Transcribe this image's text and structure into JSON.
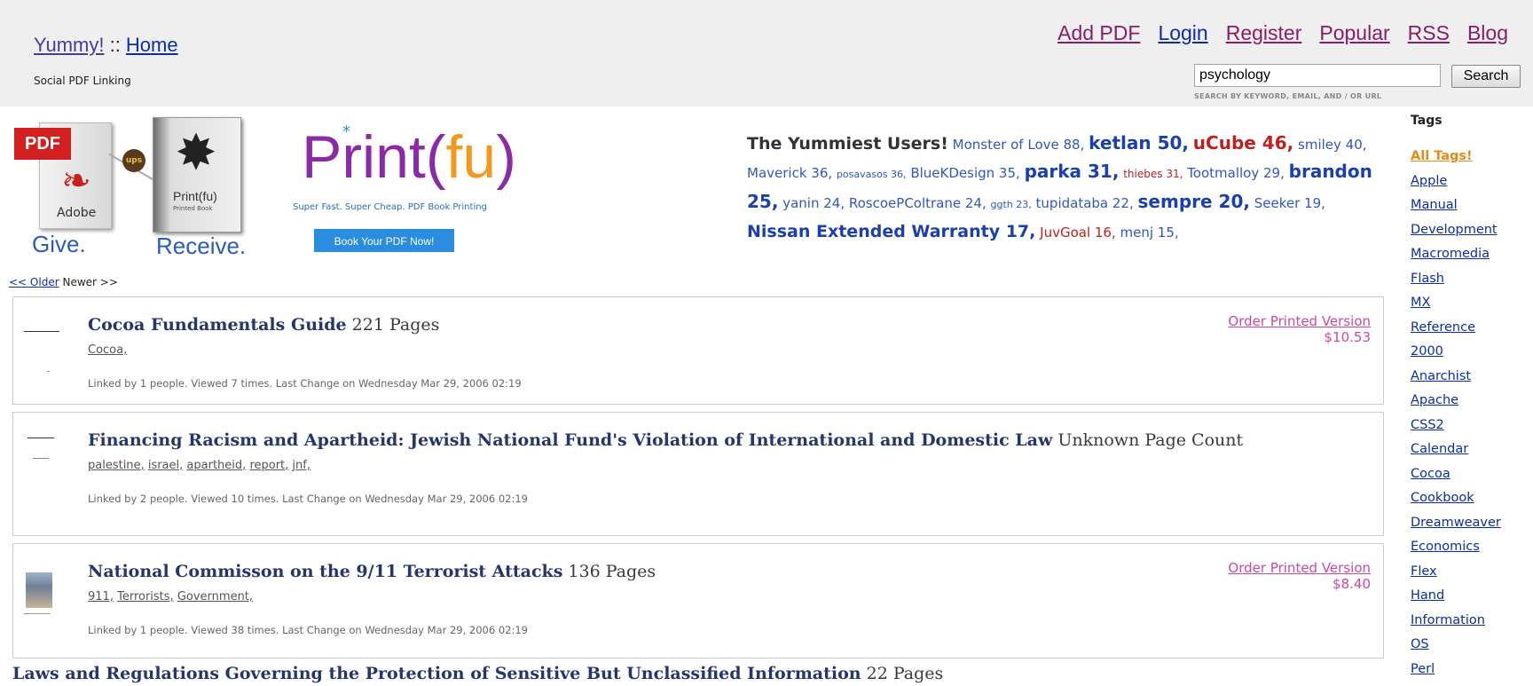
{
  "header": {
    "brand": "Yummy!",
    "separator": " :: ",
    "home": "Home",
    "tagline": "Social PDF Linking",
    "nav": [
      "Add PDF",
      "Login",
      "Register",
      "Popular",
      "RSS",
      "Blog"
    ],
    "search": {
      "value": "psychology",
      "button": "Search",
      "hint": "SEARCH BY KEYWORD, EMAIL, AND / OR URL"
    }
  },
  "banner": {
    "pdf_tag": "PDF",
    "adobe": "Adobe",
    "ups": "ups",
    "book_title": "Print(fu)",
    "book_sub": "Printed Book",
    "give": "Give.",
    "receive": "Receive.",
    "printfu_left": "Print(",
    "printfu_fu": "fu",
    "printfu_right": ")",
    "printfu_sub": "Super Fast. Super Cheap. PDF Book Printing",
    "printfu_button": "Book Your PDF Now!"
  },
  "users": {
    "lead": "The Yummiest Users!",
    "list": [
      {
        "name": "Monster of Love 88,",
        "size": 15,
        "color": "#2f57c5",
        "bold": false
      },
      {
        "name": "ketlan 50,",
        "size": 20,
        "color": "#1a3fae",
        "bold": true
      },
      {
        "name": "uCube 46,",
        "size": 20,
        "color": "#c0201e",
        "bold": true
      },
      {
        "name": "smiley 40,",
        "size": 15,
        "color": "#2f57c5",
        "bold": false
      },
      {
        "name": "Maverick 36,",
        "size": 15,
        "color": "#2f57c5",
        "bold": false
      },
      {
        "name": "posavasos 36,",
        "size": 11,
        "color": "#2f57c5",
        "bold": false
      },
      {
        "name": "BlueKDesign 35,",
        "size": 15,
        "color": "#2f57c5",
        "bold": false
      },
      {
        "name": "parka 31,",
        "size": 20,
        "color": "#1a3fae",
        "bold": true
      },
      {
        "name": "thiebes 31,",
        "size": 12,
        "color": "#c0201e",
        "bold": false
      },
      {
        "name": "Tootmalloy 29,",
        "size": 15,
        "color": "#2f57c5",
        "bold": false
      },
      {
        "name": "brandon 25,",
        "size": 20,
        "color": "#1a3fae",
        "bold": true
      },
      {
        "name": "yanin 24,",
        "size": 15,
        "color": "#2f57c5",
        "bold": false
      },
      {
        "name": "RoscoePColtrane 24,",
        "size": 15,
        "color": "#2f57c5",
        "bold": false
      },
      {
        "name": "ggth 23,",
        "size": 11,
        "color": "#2f57c5",
        "bold": false
      },
      {
        "name": "tupidataba 22,",
        "size": 15,
        "color": "#2f57c5",
        "bold": false
      },
      {
        "name": "sempre 20,",
        "size": 20,
        "color": "#1a3fae",
        "bold": true
      },
      {
        "name": "Seeker 19,",
        "size": 15,
        "color": "#2f57c5",
        "bold": false
      },
      {
        "name": "Nissan Extended Warranty 17,",
        "size": 19,
        "color": "#1a3fae",
        "bold": true
      },
      {
        "name": "JuvGoal 16,",
        "size": 15,
        "color": "#c0201e",
        "bold": false
      },
      {
        "name": "menj 15,",
        "size": 15,
        "color": "#2f57c5",
        "bold": false
      }
    ]
  },
  "tags": {
    "heading": "Tags",
    "all": "All Tags!",
    "items": [
      "Apple",
      "Manual",
      "Development",
      "Macromedia",
      "Flash",
      "MX",
      "Reference",
      "2000",
      "Anarchist",
      "Apache",
      "CSS2",
      "Calendar",
      "Cocoa",
      "Cookbook",
      "Dreamweaver",
      "Economics",
      "Flex",
      "Hand",
      "Information",
      "OS",
      "Perl"
    ]
  },
  "pager": {
    "older": "<< Older",
    "newer": "Newer >>"
  },
  "entries": [
    {
      "title": "Cocoa Fundamentals Guide",
      "pages": " 221 Pages",
      "tags": [
        "Cocoa,"
      ],
      "meta": "Linked by 1 people. Viewed 7 times. Last Change on Wednesday Mar 29, 2006 02:19",
      "order": "Order Printed Version",
      "price": "$10.53"
    },
    {
      "title": "Financing Racism and Apartheid: Jewish National Fund's Violation of International and Domestic Law",
      "pages": " Unknown Page Count",
      "tags": [
        "palestine,",
        "israel,",
        "apartheid,",
        "report,",
        "jnf,"
      ],
      "meta": "Linked by 2 people. Viewed 10 times. Last Change on Wednesday Mar 29, 2006 02:19",
      "order": "",
      "price": ""
    },
    {
      "title": "National Commisson on the 9/11 Terrorist Attacks",
      "pages": " 136 Pages",
      "tags": [
        "911,",
        "Terrorists,",
        "Government,"
      ],
      "meta": "Linked by 1 people. Viewed 38 times. Last Change on Wednesday Mar 29, 2006 02:19",
      "order": "Order Printed Version",
      "price": "$8.40"
    }
  ],
  "next_entry_title": "Laws and Regulations Governing the Protection of Sensitive But Unclassified Information",
  "next_entry_pages": " 22 Pages"
}
